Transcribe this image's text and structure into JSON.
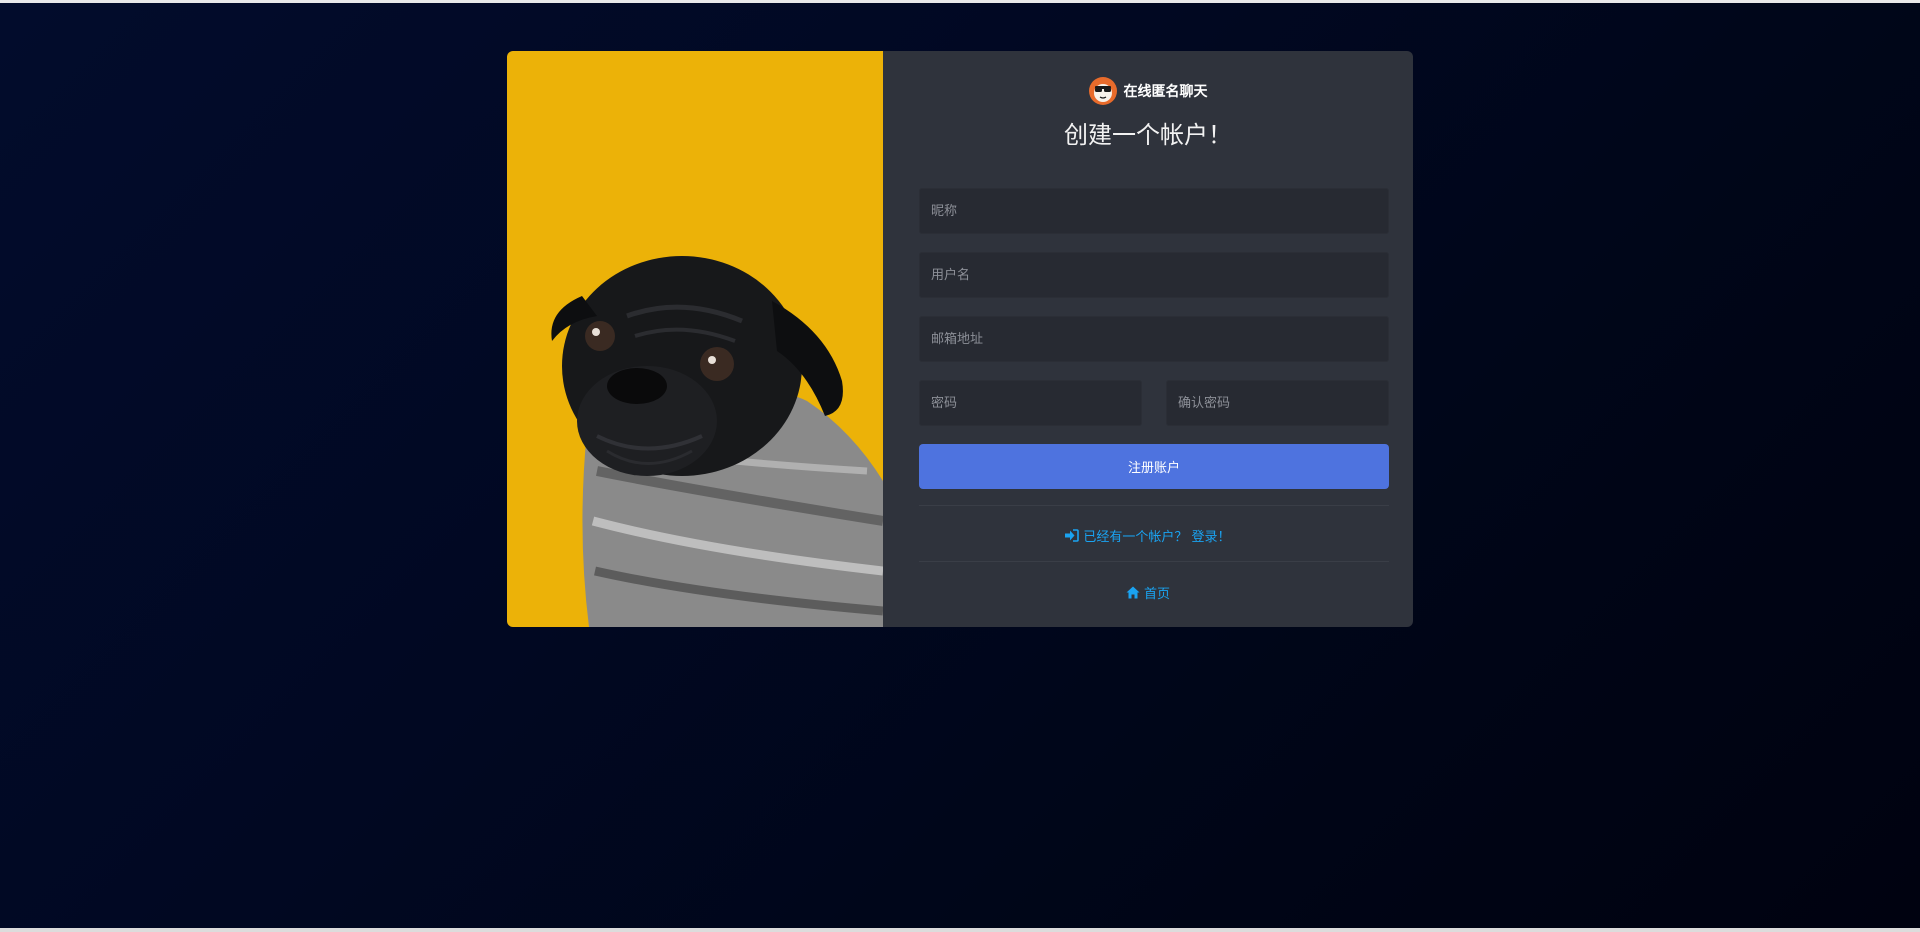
{
  "brand": {
    "name": "在线匿名聊天",
    "logo_icon": "sunglasses-avatar-icon"
  },
  "page": {
    "heading": "创建一个帐户！"
  },
  "form": {
    "nickname_placeholder": "昵称",
    "username_placeholder": "用户名",
    "email_placeholder": "邮箱地址",
    "password_placeholder": "密码",
    "confirm_password_placeholder": "确认密码",
    "submit_label": "注册账户"
  },
  "links": {
    "login_label": "已经有一个帐户？ 登录！",
    "login_icon": "sign-in-icon",
    "home_label": "首页",
    "home_icon": "home-icon"
  },
  "colors": {
    "accent": "#4e73df",
    "link": "#1aa3f1",
    "photo_background": "#ecb208",
    "panel": "#2f333c"
  }
}
